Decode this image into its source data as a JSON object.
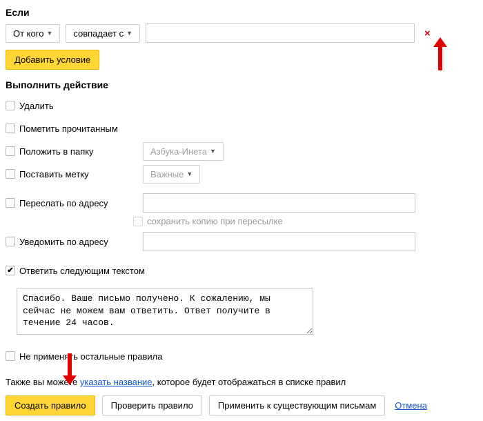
{
  "condition": {
    "title": "Если",
    "from_label": "От кого",
    "match_label": "совпадает с",
    "value": "",
    "add_button": "Добавить условие"
  },
  "actions": {
    "title": "Выполнить действие",
    "delete": "Удалить",
    "mark_read": "Пометить прочитанным",
    "move_folder": "Положить в папку",
    "folder_value": "Азбука-Инета",
    "set_label": "Поставить метку",
    "label_value": "Важные",
    "forward": "Переслать по адресу",
    "forward_keep_copy": "сохранить копию при пересылке",
    "notify": "Уведомить по адресу",
    "reply": "Ответить следующим текстом",
    "reply_text": "Спасибо. Ваше письмо получено. К сожалению, мы сейчас не можем вам ответить. Ответ получите в течение 24 часов.",
    "dont_apply_others": "Не применять остальные правила"
  },
  "footer": {
    "pre_text": "Также вы можете ",
    "link_text": "указать название",
    "post_text": ", которое будет отображаться в списке правил",
    "create": "Создать правило",
    "check": "Проверить правило",
    "apply_existing": "Применить к существующим письмам",
    "cancel": "Отмена"
  }
}
